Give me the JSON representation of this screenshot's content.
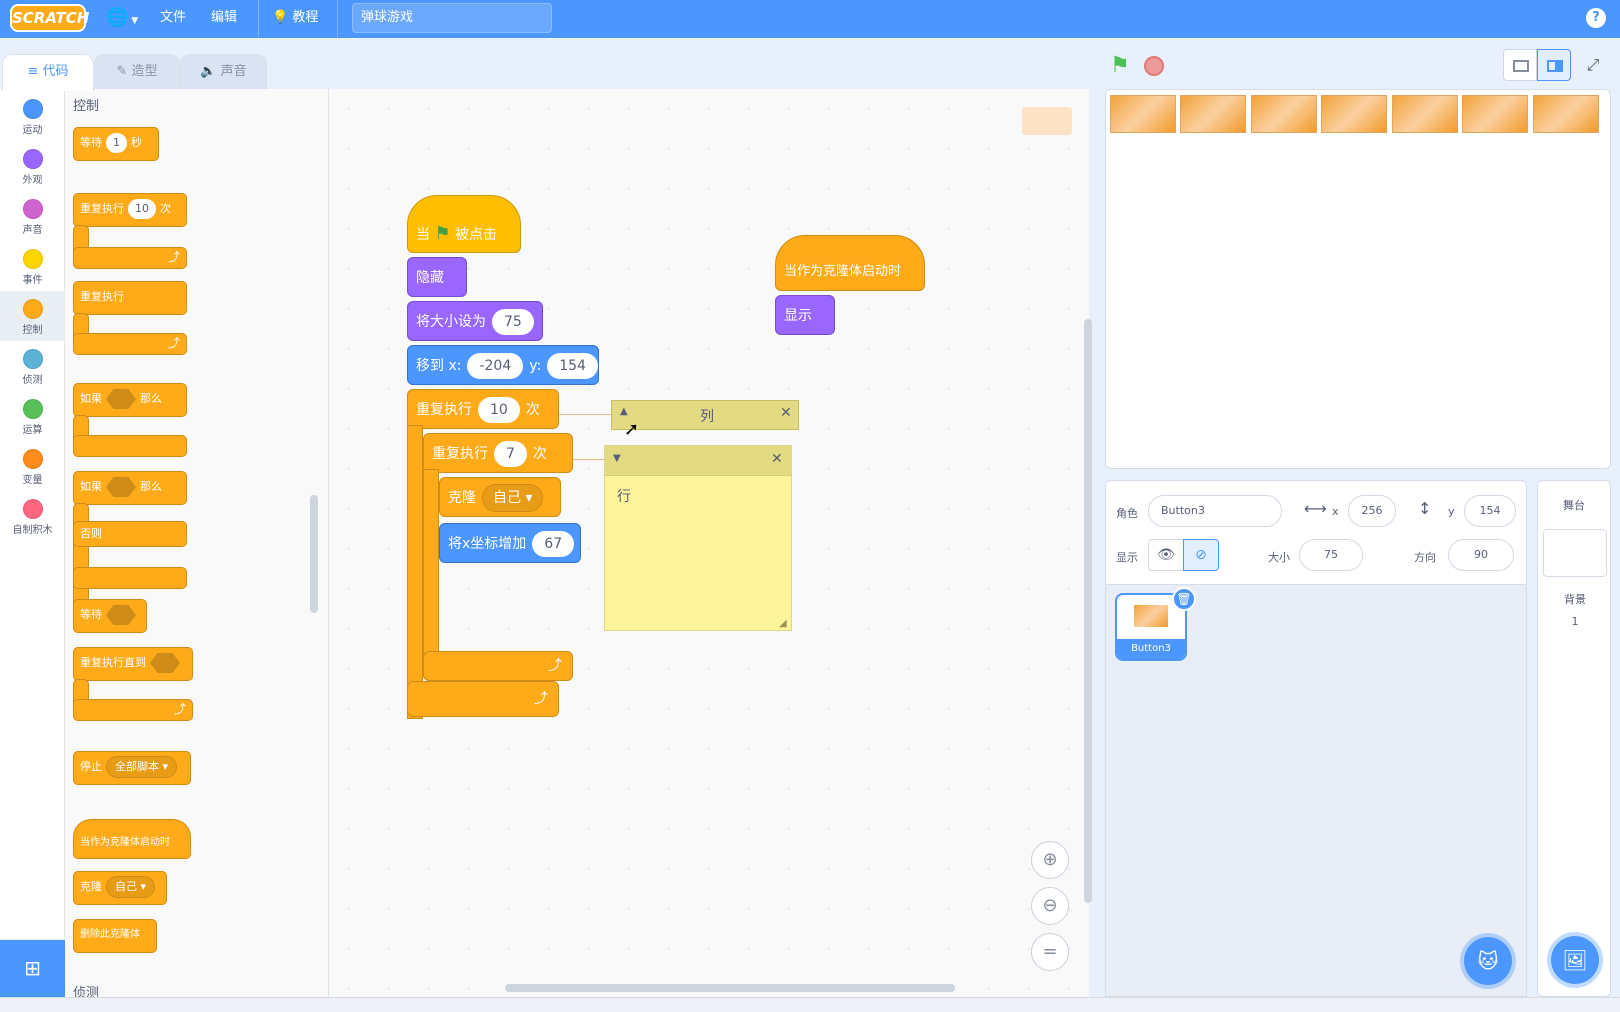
{
  "menubar": {
    "logo": "SCRATCH",
    "file": "文件",
    "edit": "编辑",
    "tutorials": "教程",
    "project_title": "弹球游戏",
    "help_icon": "question-icon"
  },
  "tabs": [
    {
      "label": "代码",
      "icon": "code-icon"
    },
    {
      "label": "造型",
      "icon": "brush-icon"
    },
    {
      "label": "声音",
      "icon": "speaker-icon"
    }
  ],
  "categories": [
    {
      "label": "运动",
      "color": "#4c97ff"
    },
    {
      "label": "外观",
      "color": "#9966ff"
    },
    {
      "label": "声音",
      "color": "#cf63cf"
    },
    {
      "label": "事件",
      "color": "#ffd500"
    },
    {
      "label": "控制",
      "color": "#ffab19"
    },
    {
      "label": "侦测",
      "color": "#5cb1d6"
    },
    {
      "label": "运算",
      "color": "#59c059"
    },
    {
      "label": "变量",
      "color": "#ff8c1a"
    },
    {
      "label": "自制积木",
      "color": "#ff6680"
    }
  ],
  "palette": {
    "heading": "控制",
    "wait_label": "等待",
    "wait_value": "1",
    "wait_unit": "秒",
    "repeat_label": "重复执行",
    "repeat_value": "10",
    "repeat_unit": "次",
    "forever_label": "重复执行",
    "if_label": "如果",
    "then_label": "那么",
    "if2_label": "如果",
    "then2_label": "那么",
    "else_label": "否则",
    "wait_until_label": "等待",
    "repeat_until_label": "重复执行直到",
    "stop_label": "停止",
    "stop_option": "全部脚本",
    "clone_start_label": "当作为克隆体启动时",
    "clone_label": "克隆",
    "clone_option": "自己",
    "delete_clone_label": "删除此克隆体",
    "next_heading": "侦测"
  },
  "script1": {
    "when": "当",
    "clicked": "被点击",
    "hide": "隐藏",
    "set_size": "将大小设为",
    "size_value": "75",
    "goto_x": "移到 x:",
    "x_value": "-204",
    "goto_y": "y:",
    "y_value": "154",
    "repeat_outer": "重复执行",
    "outer_times": "10",
    "times_unit": "次",
    "repeat_inner": "重复执行",
    "inner_times": "7",
    "times_unit2": "次",
    "clone": "克隆",
    "clone_target": "自己",
    "change_x": "将x坐标增加",
    "change_x_value": "67"
  },
  "script2": {
    "hat": "当作为克隆体启动时",
    "show": "显示"
  },
  "comments": [
    {
      "text": "列",
      "collapsed": true
    },
    {
      "text": "行",
      "collapsed": false
    }
  ],
  "stage": {
    "buttons_count": 7,
    "button_color": "#f2a23a"
  },
  "sprite_info": {
    "sprite_label": "角色",
    "sprite_name": "Button3",
    "x_label": "x",
    "x_value": "256",
    "y_label": "y",
    "y_value": "154",
    "show_label": "显示",
    "size_label": "大小",
    "size_value": "75",
    "direction_label": "方向",
    "direction_value": "90"
  },
  "sprite_list": [
    {
      "name": "Button3",
      "selected": true
    }
  ],
  "stage_pane": {
    "title": "舞台",
    "backdrop_label": "背景",
    "backdrop_count": "1"
  }
}
